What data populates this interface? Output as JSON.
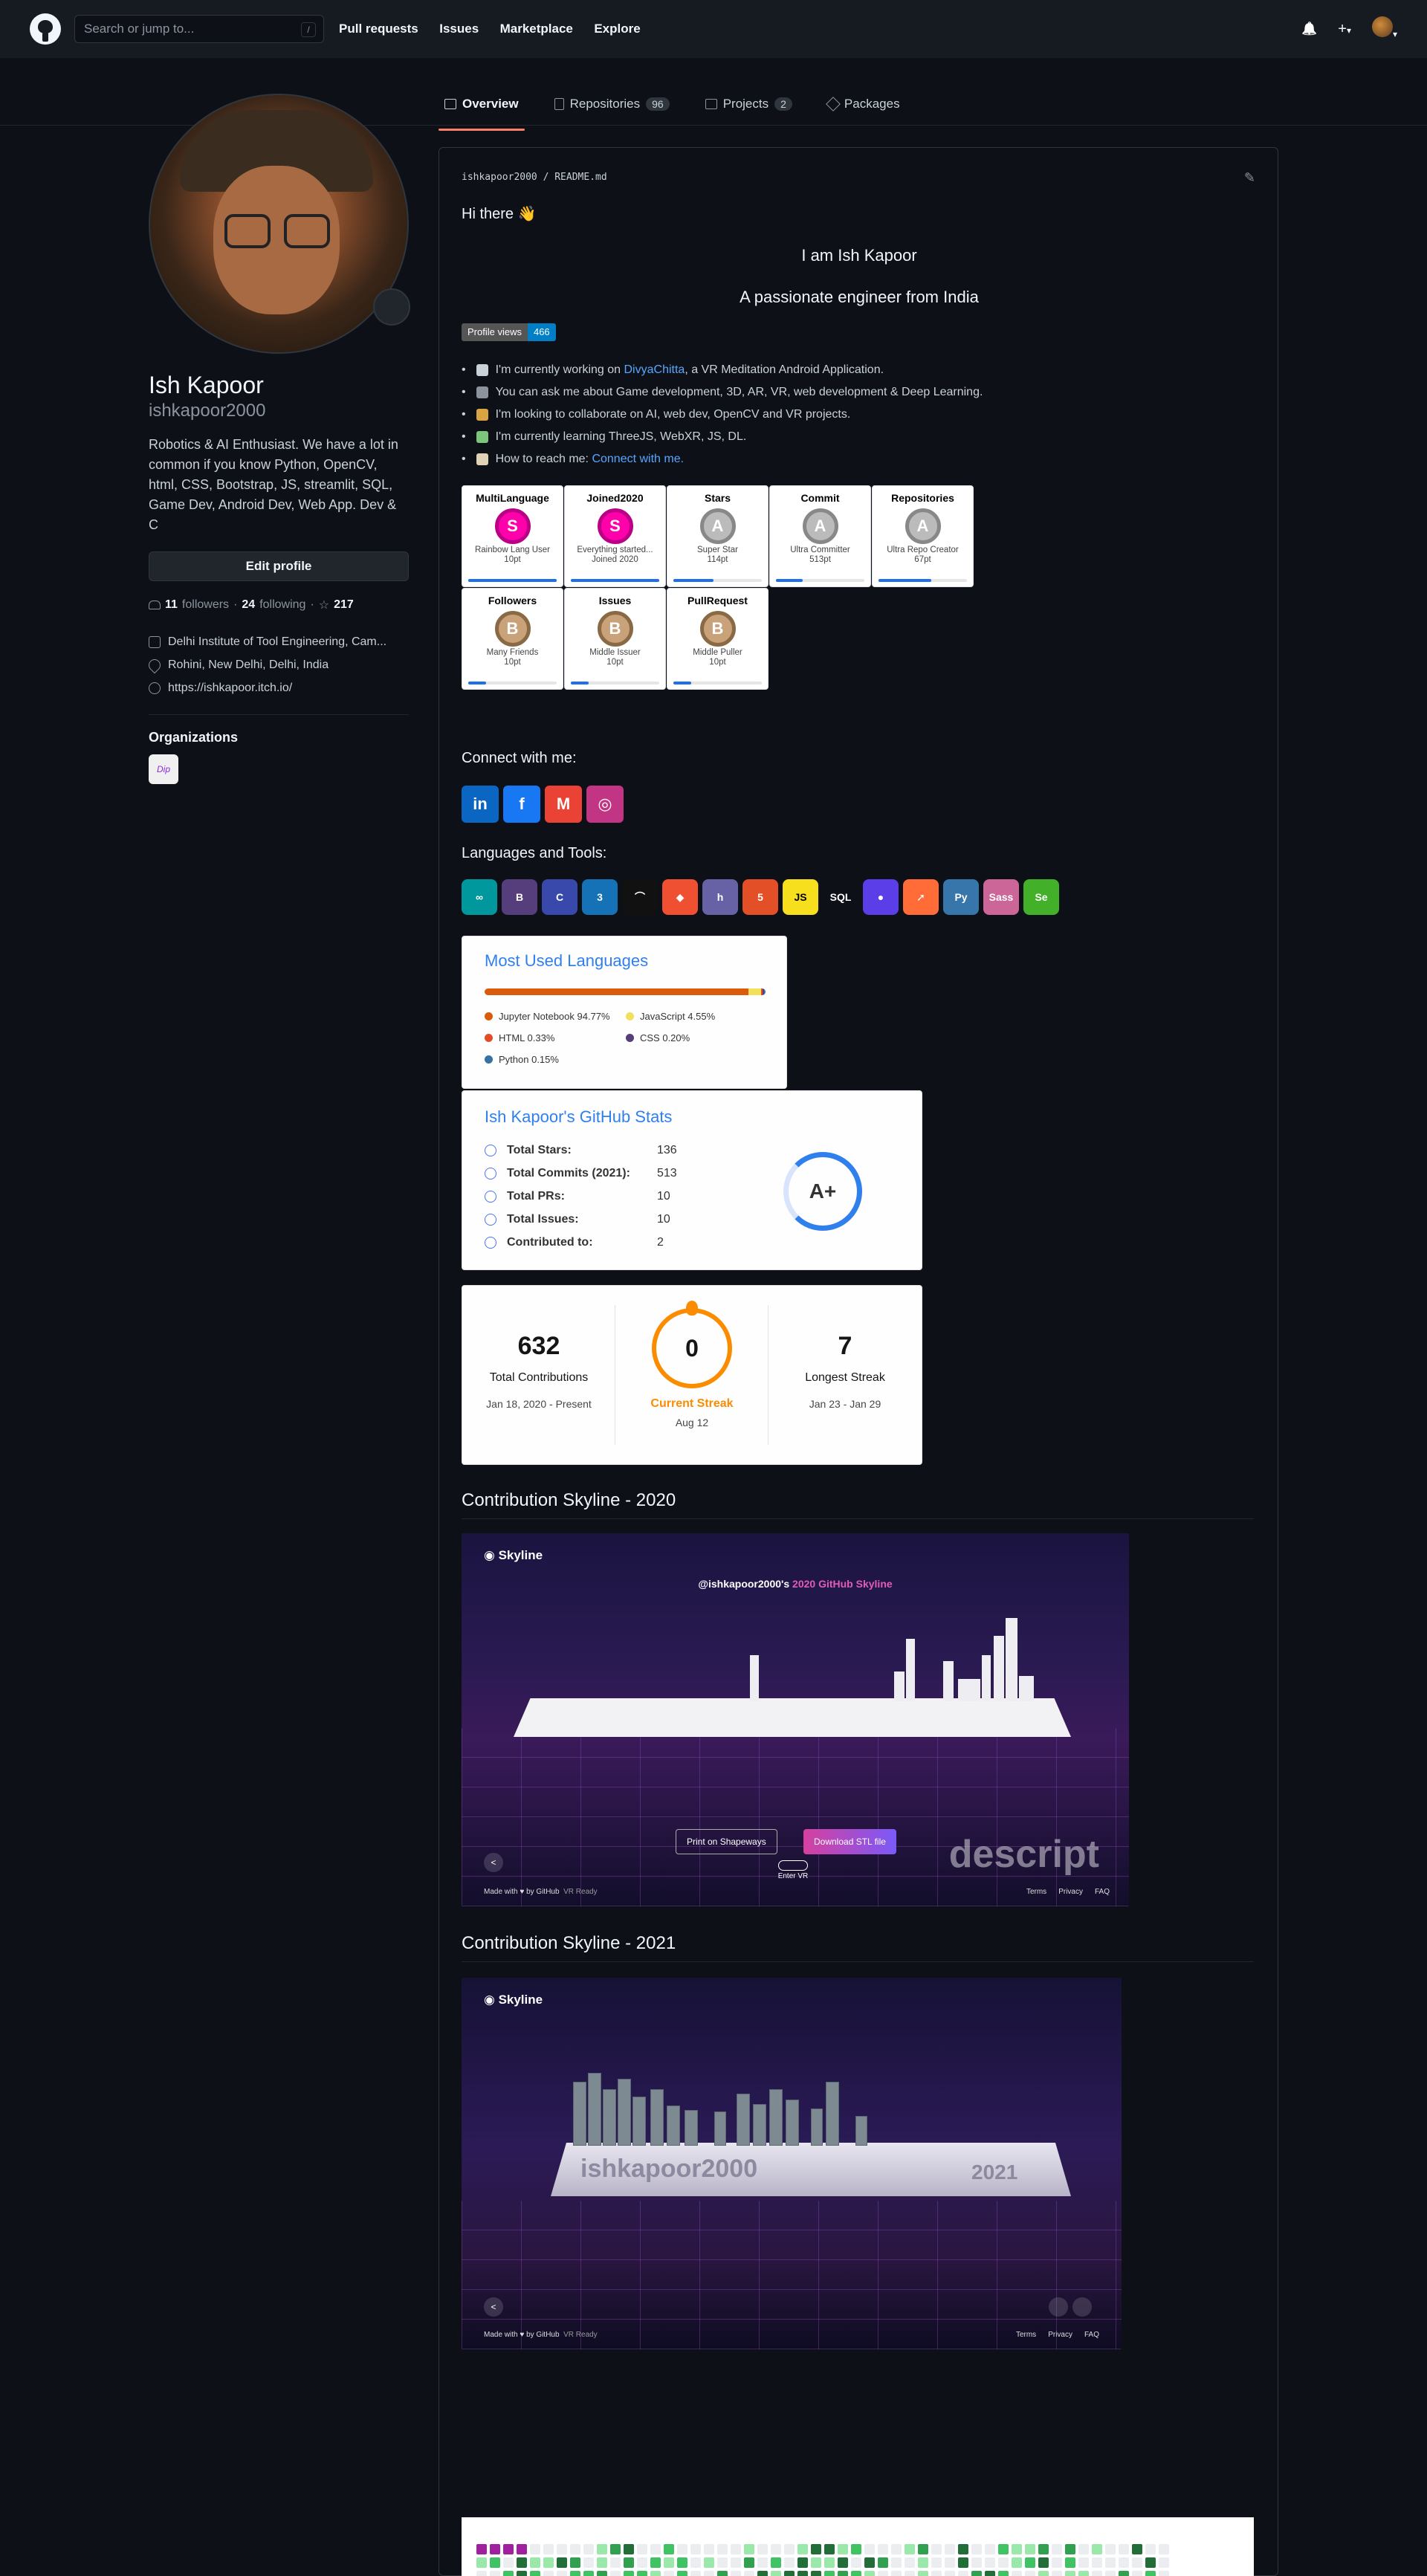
{
  "header": {
    "search_placeholder": "Search or jump to...",
    "search_hint": "/",
    "nav": [
      "Pull requests",
      "Issues",
      "Marketplace",
      "Explore"
    ],
    "plus": "+",
    "caret": "▾",
    "bell": "🔔"
  },
  "tabs": [
    {
      "label": "Overview",
      "count": ""
    },
    {
      "label": "Repositories",
      "count": "96"
    },
    {
      "label": "Projects",
      "count": "2"
    },
    {
      "label": "Packages",
      "count": ""
    }
  ],
  "profile": {
    "name": "Ish Kapoor",
    "login": "ishkapoor2000",
    "bio": "Robotics & AI Enthusiast. We have a lot in common if you know Python, OpenCV, html, CSS, Bootstrap, JS, streamlit, SQL, Game Dev, Android Dev, Web App. Dev & C",
    "edit_label": "Edit profile",
    "followers": "11",
    "followers_label": "followers",
    "dot": "·",
    "following": "24",
    "following_label": "following",
    "stars": "217",
    "org_label": "Delhi Institute of Tool Engineering, Cam...",
    "location": "Rohini, New Delhi, Delhi, India",
    "website": "https://ishkapoor.itch.io/",
    "organizations_heading": "Organizations",
    "org_logo_text": "Dip"
  },
  "readme": {
    "path_user": "ishkapoor2000",
    "path_sep": "/",
    "path_file": "README.md",
    "hi": "Hi there 👋",
    "heading1": "I am Ish Kapoor",
    "heading2": "A passionate engineer from India",
    "views_label": "Profile views",
    "views_value": "466",
    "bullets": [
      {
        "pre": "I'm currently working on ",
        "link": "DivyaChitta",
        "post": ", a VR Meditation Android Application.",
        "icon_color": "#c9d1d9"
      },
      {
        "pre": "You can ask me about Game development, 3D, AR, VR, web development & Deep Learning.",
        "link": "",
        "post": "",
        "icon_color": "#8b949e"
      },
      {
        "pre": "I'm looking to collaborate on AI, web dev, OpenCV and VR projects.",
        "link": "",
        "post": "",
        "icon_color": "#d9a441"
      },
      {
        "pre": "I'm currently learning ThreeJS, WebXR, JS, DL.",
        "link": "",
        "post": "",
        "icon_color": "#7bc67b"
      },
      {
        "pre": "How to reach me: ",
        "link": "Connect with me.",
        "post": "",
        "icon_color": "#e0d2b4"
      }
    ],
    "trophies": [
      {
        "title": "MultiLanguage",
        "rank": "S",
        "name": "Rainbow Lang User",
        "pts": "10pt",
        "level": 1.0
      },
      {
        "title": "Joined2020",
        "rank": "S",
        "name": "Everything started...",
        "pts": "Joined 2020",
        "level": 1.0
      },
      {
        "title": "Stars",
        "rank": "A",
        "name": "Super Star",
        "pts": "114pt",
        "level": 0.45
      },
      {
        "title": "Commit",
        "rank": "A",
        "name": "Ultra Committer",
        "pts": "513pt",
        "level": 0.3
      },
      {
        "title": "Repositories",
        "rank": "A",
        "name": "Ultra Repo Creator",
        "pts": "67pt",
        "level": 0.6
      },
      {
        "title": "Followers",
        "rank": "B",
        "name": "Many Friends",
        "pts": "10pt",
        "level": 0.2
      },
      {
        "title": "Issues",
        "rank": "B",
        "name": "Middle Issuer",
        "pts": "10pt",
        "level": 0.2
      },
      {
        "title": "PullRequest",
        "rank": "B",
        "name": "Middle Puller",
        "pts": "10pt",
        "level": 0.2
      }
    ],
    "connect_heading": "Connect with me:",
    "social": [
      {
        "name": "linkedin-icon",
        "glyph": "in",
        "color": "#0a66c2"
      },
      {
        "name": "facebook-icon",
        "glyph": "f",
        "color": "#1877f2"
      },
      {
        "name": "gmail-icon",
        "glyph": "M",
        "color": "#ea4335"
      },
      {
        "name": "instagram-icon",
        "glyph": "◎",
        "color": "#c13584"
      }
    ],
    "tools_heading": "Languages and Tools:",
    "tools": [
      {
        "name": "arduino-icon",
        "glyph": "∞",
        "color": "#00979d"
      },
      {
        "name": "bootstrap-icon",
        "glyph": "B",
        "color": "#563d7c"
      },
      {
        "name": "c-icon",
        "glyph": "C",
        "color": "#3949ab"
      },
      {
        "name": "css3-icon",
        "glyph": "3",
        "color": "#1572b6"
      },
      {
        "name": "flask-icon",
        "glyph": "⌒",
        "color": "#111111"
      },
      {
        "name": "git-icon",
        "glyph": "◆",
        "color": "#f05032"
      },
      {
        "name": "heroku-icon",
        "glyph": "h",
        "color": "#6762a6"
      },
      {
        "name": "html5-icon",
        "glyph": "5",
        "color": "#e34f26"
      },
      {
        "name": "javascript-icon",
        "glyph": "JS",
        "color": "#f7df1e"
      },
      {
        "name": "mysql-icon",
        "glyph": "SQL",
        "color": "#0d1117"
      },
      {
        "name": "opencv-icon",
        "glyph": "●",
        "color": "#5c3ee8"
      },
      {
        "name": "postman-icon",
        "glyph": "➚",
        "color": "#ff6c37"
      },
      {
        "name": "python-icon",
        "glyph": "Py",
        "color": "#3776ab"
      },
      {
        "name": "sass-icon",
        "glyph": "Sass",
        "color": "#cc6699"
      },
      {
        "name": "selenium-icon",
        "glyph": "Se",
        "color": "#43b02a"
      }
    ],
    "top_langs": {
      "title": "Most Used Languages",
      "items": [
        {
          "name": "Jupyter Notebook",
          "pct": "94.77%",
          "value": 94.77,
          "color": "#da5b0b"
        },
        {
          "name": "JavaScript",
          "pct": "4.55%",
          "value": 4.55,
          "color": "#f1e05a"
        },
        {
          "name": "HTML",
          "pct": "0.33%",
          "value": 0.33,
          "color": "#e34c26"
        },
        {
          "name": "CSS",
          "pct": "0.20%",
          "value": 0.2,
          "color": "#563d7c"
        },
        {
          "name": "Python",
          "pct": "0.15%",
          "value": 0.15,
          "color": "#3572a5"
        }
      ]
    },
    "stats": {
      "title": "Ish Kapoor's GitHub Stats",
      "rows": [
        {
          "label": "Total Stars:",
          "value": "136"
        },
        {
          "label": "Total Commits (2021):",
          "value": "513"
        },
        {
          "label": "Total PRs:",
          "value": "10"
        },
        {
          "label": "Total Issues:",
          "value": "10"
        },
        {
          "label": "Contributed to:",
          "value": "2"
        }
      ],
      "grade": "A+"
    },
    "streak": {
      "total": "632",
      "total_label": "Total Contributions",
      "total_range": "Jan 18, 2020 - Present",
      "current": "0",
      "current_label": "Current Streak",
      "current_date": "Aug 12",
      "longest": "7",
      "longest_label": "Longest Streak",
      "longest_range": "Jan 23 - Jan 29"
    },
    "skyline1": {
      "heading": "Contribution Skyline - 2020",
      "brand": "Skyline",
      "caption_pre": "@ishkapoor2000's ",
      "caption_hl": "2020 GitHub Skyline",
      "print_btn": "Print on Shapeways",
      "download_btn": "Download STL file",
      "made_with": "Made with ♥ by GitHub",
      "vr_ready": "VR Ready",
      "terms": "Terms",
      "privacy": "Privacy",
      "faq": "FAQ",
      "enter_vr": "Enter VR",
      "watermark": "descript"
    },
    "skyline2": {
      "heading": "Contribution Skyline - 2021",
      "brand": "Skyline",
      "plate_text": "ishkapoor2000",
      "plate_year": "2021",
      "made_with": "Made with ♥ by GitHub",
      "vr_ready": "VR Ready",
      "terms": "Terms",
      "privacy": "Privacy",
      "faq": "FAQ"
    }
  }
}
